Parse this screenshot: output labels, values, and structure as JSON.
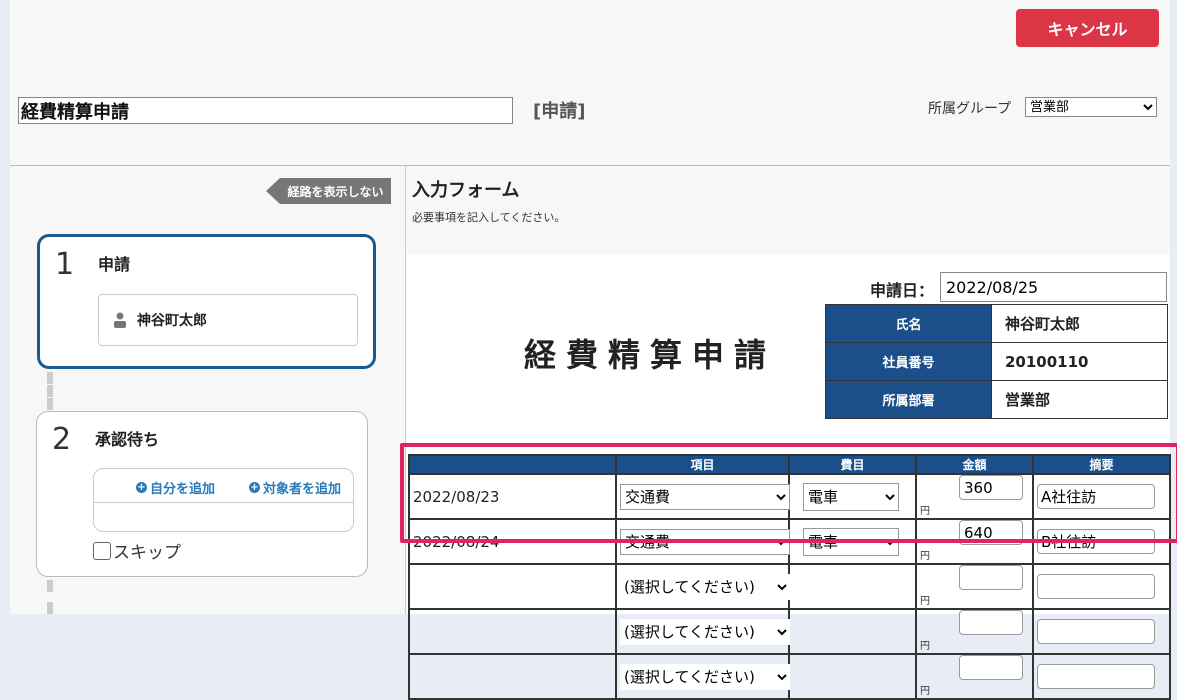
{
  "header": {
    "cancel_label": "キャンセル",
    "title_value": "経費精算申請",
    "status_label": "[申請]",
    "group_label": "所属グループ",
    "group_selected": "営業部"
  },
  "route": {
    "toggle_label": "経路を表示しない",
    "steps": [
      {
        "number": "1",
        "title": "申請",
        "person": "神谷町太郎"
      },
      {
        "number": "2",
        "title": "承認待ち",
        "add_self": "自分を追加",
        "add_target": "対象者を追加",
        "skip_label": "スキップ"
      }
    ]
  },
  "form": {
    "heading": "入力フォーム",
    "subtext": "必要事項を記入してください。",
    "date_label": "申請日：",
    "date_value": "2022/08/25",
    "doc_title": "経費精算申請",
    "info": [
      {
        "label": "氏名",
        "value": "神谷町太郎"
      },
      {
        "label": "社員番号",
        "value": "20100110"
      },
      {
        "label": "所属部署",
        "value": "営業部"
      }
    ],
    "table": {
      "headers": [
        "",
        "項目",
        "費目",
        "金額",
        "摘要"
      ],
      "currency": "円",
      "rows": [
        {
          "date": "2022/08/23",
          "item": "交通費",
          "category": "電車",
          "amount": "360",
          "memo": "A社往訪"
        },
        {
          "date": "2022/08/24",
          "item": "交通費",
          "category": "電車",
          "amount": "640",
          "memo": "B社往訪"
        },
        {
          "date": "",
          "item": "(選択してください)",
          "category": "",
          "amount": "",
          "memo": ""
        },
        {
          "date": "",
          "item": "(選択してください)",
          "category": "",
          "amount": "",
          "memo": ""
        },
        {
          "date": "",
          "item": "(選択してください)",
          "category": "",
          "amount": "",
          "memo": ""
        }
      ]
    }
  },
  "colors": {
    "cancel": "#dc3545",
    "header_blue": "#1b4f8a",
    "active_step_border": "#1b5a8e",
    "highlight": "#e0245e"
  }
}
